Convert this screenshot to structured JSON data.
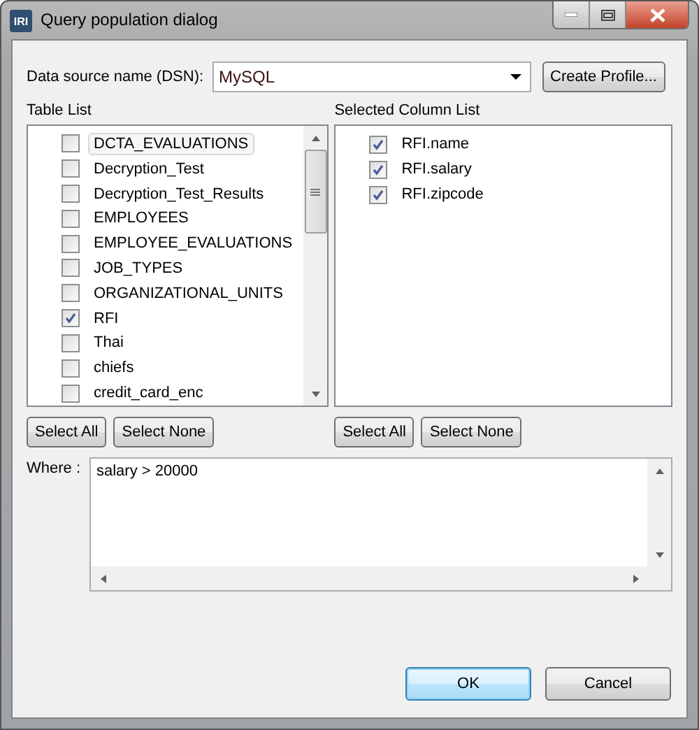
{
  "window": {
    "title": "Query population dialog",
    "app_icon": "IRI"
  },
  "dsn": {
    "label": "Data source name (DSN):",
    "value": "MySQL",
    "button": "Create Profile..."
  },
  "table_list": {
    "label": "Table List",
    "items": [
      {
        "name": "DCTA_EVALUATIONS",
        "checked": false,
        "focused": true
      },
      {
        "name": "Decryption_Test",
        "checked": false,
        "focused": false
      },
      {
        "name": "Decryption_Test_Results",
        "checked": false,
        "focused": false
      },
      {
        "name": "EMPLOYEES",
        "checked": false,
        "focused": false
      },
      {
        "name": "EMPLOYEE_EVALUATIONS",
        "checked": false,
        "focused": false
      },
      {
        "name": "JOB_TYPES",
        "checked": false,
        "focused": false
      },
      {
        "name": "ORGANIZATIONAL_UNITS",
        "checked": false,
        "focused": false
      },
      {
        "name": "RFI",
        "checked": true,
        "focused": false
      },
      {
        "name": "Thai",
        "checked": false,
        "focused": false
      },
      {
        "name": "chiefs",
        "checked": false,
        "focused": false
      },
      {
        "name": "credit_card_enc",
        "checked": false,
        "focused": false
      }
    ],
    "buttons": [
      "Select All",
      "Select None"
    ]
  },
  "column_list": {
    "label": "Selected Column List",
    "items": [
      {
        "name": "RFI.name",
        "checked": true
      },
      {
        "name": "RFI.salary",
        "checked": true
      },
      {
        "name": "RFI.zipcode",
        "checked": true
      }
    ],
    "buttons": [
      "Select All",
      "Select None"
    ]
  },
  "where": {
    "label": "Where :",
    "value": "salary > 20000"
  },
  "buttons": [
    {
      "label": "OK",
      "default": true
    },
    {
      "label": "Cancel",
      "default": false
    }
  ]
}
